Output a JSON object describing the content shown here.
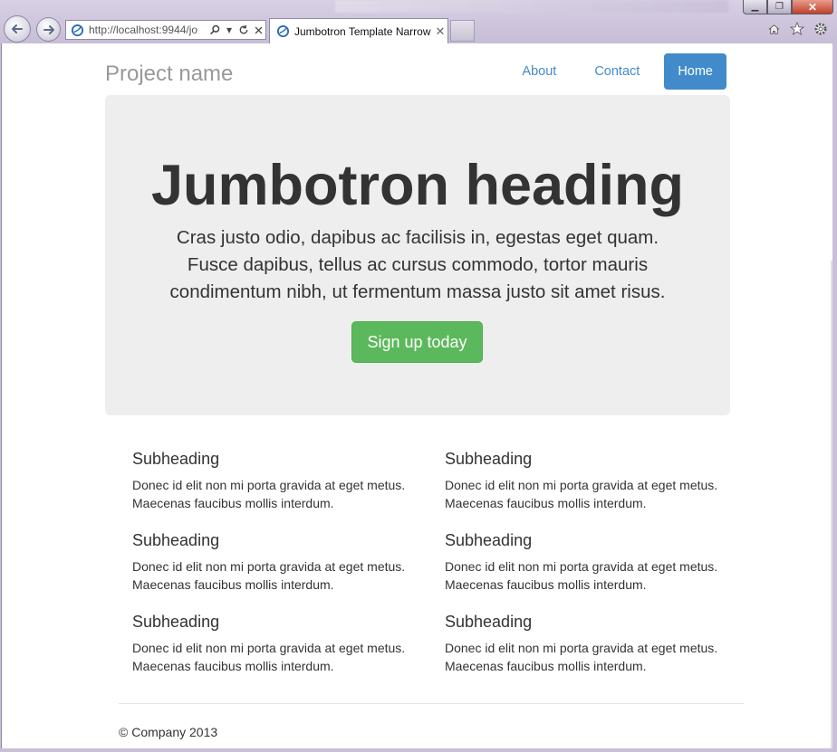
{
  "browser": {
    "address_url_host": "http://localhost",
    "address_url_rest": ":9944/jo",
    "tab_title": "Jumbotron Template Narrow"
  },
  "site": {
    "brand": "Project name",
    "nav": [
      {
        "label": "About",
        "active": false
      },
      {
        "label": "Contact",
        "active": false
      },
      {
        "label": "Home",
        "active": true
      }
    ]
  },
  "jumbotron": {
    "heading": "Jumbotron heading",
    "lead": "Cras justo odio, dapibus ac facilisis in, egestas eget quam. Fusce dapibus, tellus ac cursus commodo, tortor mauris condimentum nibh, ut fermentum massa justo sit amet risus.",
    "button_label": "Sign up today"
  },
  "marketing": {
    "left": [
      {
        "heading": "Subheading",
        "text": "Donec id elit non mi porta gravida at eget metus. Maecenas faucibus mollis interdum."
      },
      {
        "heading": "Subheading",
        "text": "Donec id elit non mi porta gravida at eget metus. Maecenas faucibus mollis interdum."
      },
      {
        "heading": "Subheading",
        "text": "Donec id elit non mi porta gravida at eget metus. Maecenas faucibus mollis interdum."
      }
    ],
    "right": [
      {
        "heading": "Subheading",
        "text": "Donec id elit non mi porta gravida at eget metus. Maecenas faucibus mollis interdum."
      },
      {
        "heading": "Subheading",
        "text": "Donec id elit non mi porta gravida at eget metus. Maecenas faucibus mollis interdum."
      },
      {
        "heading": "Subheading",
        "text": "Donec id elit non mi porta gravida at eget metus. Maecenas faucibus mollis interdum."
      }
    ]
  },
  "footer": {
    "text": "© Company 2013"
  },
  "colors": {
    "primary": "#428bca",
    "success": "#5cb85c",
    "jumbotron_bg": "#eeeeee",
    "brand_text": "#999999"
  },
  "icons": {
    "back": "back-arrow-icon",
    "forward": "forward-arrow-icon",
    "site": "ie-site-icon",
    "search": "search-icon",
    "dropdown": "chevron-down-icon",
    "refresh": "refresh-icon",
    "stop": "close-icon",
    "home": "home-icon",
    "favorites": "star-icon",
    "tools": "gear-icon"
  }
}
